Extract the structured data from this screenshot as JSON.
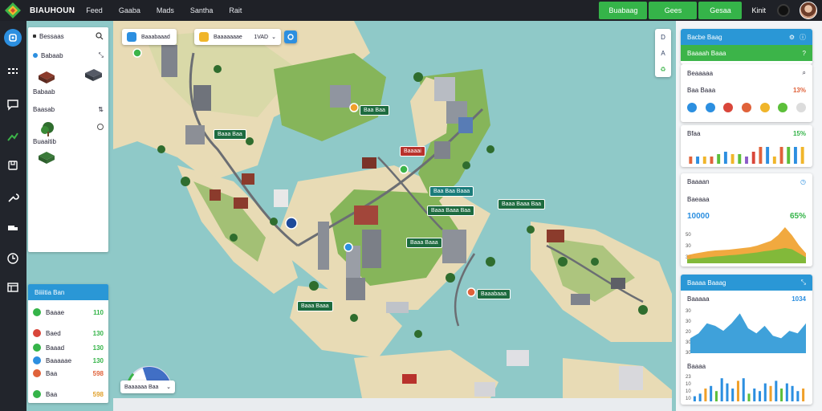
{
  "app": {
    "brand": "BIAUHOUN",
    "nav": [
      "Feed",
      "Gaaba",
      "Mads",
      "Santha",
      "Rait"
    ],
    "top_buttons": [
      "Buabaag",
      "Gees",
      "Gesaa"
    ],
    "user_label": "Kinit"
  },
  "colors": {
    "topbar": "#1f2127",
    "rail": "#22252c",
    "accent_blue": "#2c8fe0",
    "accent_green": "#35b449",
    "water": "#8fc9c8",
    "land": "#e8dbb5",
    "grass": "#86b55a"
  },
  "left_panel": {
    "search_label": "Bessaas",
    "section1_label": "Babaab",
    "section2_label": "Baasab",
    "section2_caption": "Buaaitib"
  },
  "bottom_left_panel": {
    "title": "Biiiitia Ban",
    "rows": [
      {
        "label": "Baaae",
        "value": "110",
        "color": "#35b449"
      },
      {
        "label": "Baed",
        "value": "130",
        "color": "#d9463a"
      },
      {
        "label": "Baaad",
        "value": "130",
        "color": "#35b449"
      },
      {
        "label": "Baaaaae",
        "value": "130",
        "color": "#2c8fe0"
      },
      {
        "label": "Baa",
        "value": "598",
        "color": "#e0623a"
      },
      {
        "label": "Baa",
        "value": "598",
        "color": "#35b449"
      }
    ]
  },
  "map": {
    "search1": "Baaabaaad",
    "search2": "Baaaaaaae",
    "search2_value": "1VAD",
    "controls": [
      "D",
      "A"
    ],
    "labels": [
      {
        "text": "Baa Baa"
      },
      {
        "text": "Baaa Baa"
      },
      {
        "text": "Baaaai"
      },
      {
        "text": "Baa Baa Baaa"
      },
      {
        "text": "Baaa Baaa Baa"
      },
      {
        "text": "Baaa Baaa Baa"
      },
      {
        "text": "Baaa Baaa"
      },
      {
        "text": "Baaabaaa"
      },
      {
        "text": "Baaa Baaa"
      }
    ],
    "gauge_label": "Baaaaaa Baa",
    "gauge_level": 0.4
  },
  "right_panels": {
    "p1_title": "Bacbe Baag",
    "p2_title": "Baaaah Baaa",
    "p2_row1": "Beaaaaa",
    "p2_row2_label": "Baa Baaa",
    "p2_row2_value": "13%",
    "palette": [
      "#2c8fe0",
      "#2c8fe0",
      "#d9463a",
      "#e0623a",
      "#f0b52a",
      "#5cbf3a",
      "#dcdcdc"
    ],
    "p3_label": "Bfaa",
    "p3_value": "15%",
    "p4_label": "Baaaan",
    "p4_sub": "Baeaaa",
    "p4_big": "10000",
    "p4_pct": "65%",
    "p4_y_ticks": [
      "50",
      "30",
      "30"
    ],
    "p5_title": "Baaaa Baaag",
    "p5_row1_label": "Baaaaa",
    "p5_row1_value": "1034",
    "p5_y_ticks": [
      "30",
      "30",
      "20",
      "30",
      "30"
    ],
    "p6_label": "Baaaa",
    "p6_y_ticks": [
      "23",
      "10",
      "10",
      "10"
    ]
  },
  "chart_data": [
    {
      "type": "bar",
      "title": "",
      "values": [
        30,
        30,
        30,
        30,
        40,
        50,
        40,
        40,
        30,
        50,
        70,
        70,
        30,
        70,
        70,
        70,
        70
      ]
    },
    {
      "type": "area",
      "title": "",
      "series": [
        {
          "values": [
            20,
            24,
            27,
            30,
            32,
            33,
            34,
            36,
            38,
            40,
            44,
            50,
            56,
            70,
            90,
            70,
            45,
            25
          ]
        },
        {
          "values": [
            10,
            12,
            13,
            15,
            17,
            18,
            20,
            21,
            23,
            25,
            27,
            30,
            32,
            35,
            38,
            35,
            25,
            15
          ]
        }
      ],
      "ylim": [
        0,
        100
      ]
    },
    {
      "type": "area",
      "title": "",
      "series": [
        {
          "values": [
            30,
            40,
            60,
            55,
            45,
            60,
            80,
            50,
            40,
            55,
            35,
            30,
            45,
            40,
            60
          ]
        }
      ],
      "ylim": [
        0,
        100
      ]
    },
    {
      "type": "bar",
      "title": "",
      "values": [
        20,
        30,
        50,
        60,
        40,
        90,
        70,
        50,
        80,
        90,
        30,
        50,
        40,
        70,
        60,
        80,
        50,
        70,
        60,
        40,
        50
      ]
    }
  ]
}
